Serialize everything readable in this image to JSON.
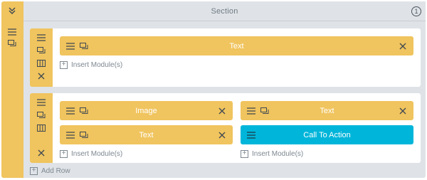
{
  "section": {
    "title": "Section",
    "help_label": "1"
  },
  "rows": [
    {
      "columns": [
        {
          "modules": [
            {
              "label": "Text",
              "color": "#f0c45e"
            }
          ],
          "insert_label": "Insert Module(s)"
        }
      ]
    },
    {
      "columns": [
        {
          "modules": [
            {
              "label": "Image",
              "color": "#f0c45e"
            },
            {
              "label": "Text",
              "color": "#f0c45e"
            }
          ],
          "insert_label": "Insert Module(s)"
        },
        {
          "modules": [
            {
              "label": "Text",
              "color": "#f0c45e"
            },
            {
              "label": "Call To Action",
              "color": "#00b5da"
            }
          ],
          "insert_label": "Insert Module(s)"
        }
      ]
    }
  ],
  "add_row_label": "Add Row",
  "colors": {
    "module_accent": "#f0c45e",
    "call_to_action_accent": "#00b5da",
    "section_background": "#dfe3e7"
  },
  "icons": {
    "collapse": "chevrons-down-icon",
    "move": "hamburger-icon",
    "duplicate": "duplicate-icon",
    "columns": "columns-icon",
    "delete": "close-icon",
    "add": "plus-square-icon"
  }
}
